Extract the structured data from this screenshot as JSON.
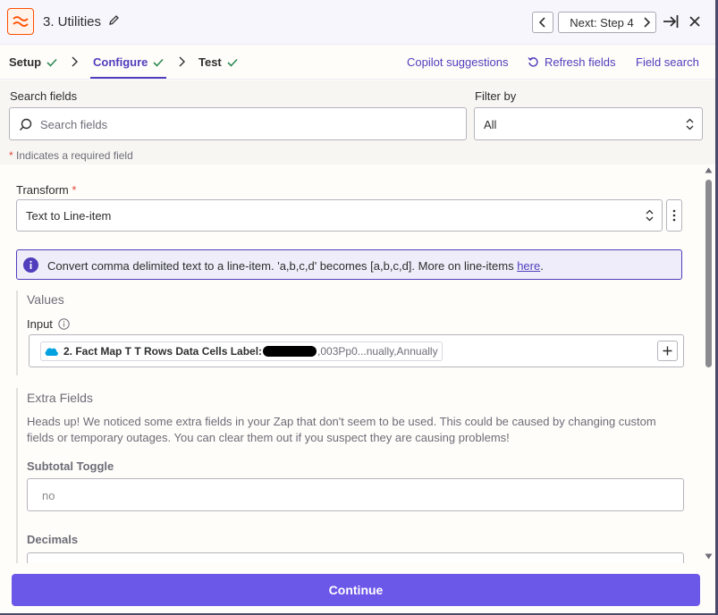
{
  "header": {
    "step_title": "3. Utilities",
    "next_label": "Next: Step 4"
  },
  "tabs": [
    {
      "label": "Setup"
    },
    {
      "label": "Configure"
    },
    {
      "label": "Test"
    }
  ],
  "links": {
    "copilot": "Copilot suggestions",
    "refresh": "Refresh fields",
    "field_search": "Field search"
  },
  "search": {
    "label": "Search fields",
    "placeholder": "Search fields",
    "filter_label": "Filter by",
    "filter_value": "All",
    "required_note": "Indicates a required field"
  },
  "transform": {
    "label": "Transform",
    "value": "Text to Line-item"
  },
  "info": {
    "text": "Convert comma delimited text to a line-item. 'a,b,c,d' becomes [a,b,c,d]. More on line-items",
    "link": "here",
    "suffix": "."
  },
  "values": {
    "title": "Values",
    "input_label": "Input",
    "pill_bold": "2. Fact Map T T Rows Data Cells Label:",
    "pill_rest": ",003Pp0...nually,Annually"
  },
  "extra": {
    "title": "Extra Fields",
    "description": "Heads up! We noticed some extra fields in your Zap that don't seem to be used. This could be caused by changing custom fields or temporary outages. You can clear them out if you suspect they are causing problems!",
    "subtotal_label": "Subtotal Toggle",
    "subtotal_value": "no",
    "decimals_label": "Decimals"
  },
  "footer": {
    "continue_label": "Continue"
  },
  "colors": {
    "accent": "#503ebd",
    "button": "#6b57e8",
    "brand": "#ff4f00",
    "success": "#2e8b57",
    "required": "#e2483d"
  }
}
